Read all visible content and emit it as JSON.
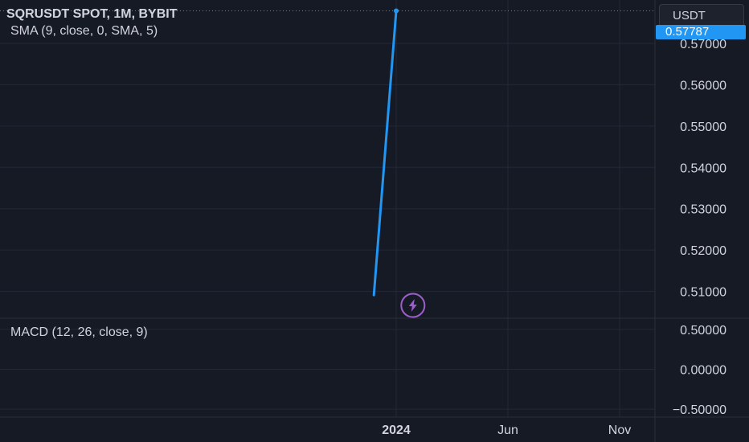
{
  "header": {
    "symbol_title": "SQRUSDT SPOT, 1M, BYBIT",
    "indicator_sma": "SMA (9, close, 0, SMA, 5)",
    "indicator_macd": "MACD (12, 26, close, 9)",
    "currency": "USDT",
    "last_price": "0.57787"
  },
  "colors": {
    "background": "#161a25",
    "grid": "#242837",
    "line": "#2196f3",
    "text": "#d1d4dc",
    "event_marker": "#9c5fc9"
  },
  "chart_data": [
    {
      "type": "line",
      "title": "SQRUSDT SPOT, 1M, BYBIT",
      "x": [
        "2023-12",
        "2024-01"
      ],
      "y": [
        0.5091,
        0.57787
      ],
      "ylim": [
        0.5035,
        0.5805
      ],
      "y_ticks": [
        0.51,
        0.52,
        0.53,
        0.54,
        0.55,
        0.56,
        0.57
      ],
      "y_tick_labels": [
        "0.51000",
        "0.52000",
        "0.53000",
        "0.54000",
        "0.55000",
        "0.56000",
        "0.57000"
      ],
      "x_ticks": [
        "2024-01",
        "2024-06",
        "2024-11"
      ],
      "x_tick_labels": [
        "2024",
        "Jun",
        "Nov"
      ],
      "last_price_line": 0.57787,
      "event_icon": "lightning-icon",
      "grid": true
    },
    {
      "type": "line",
      "title": "MACD (12, 26, close, 9)",
      "series": [],
      "ylim": [
        -0.6,
        0.64
      ],
      "y_ticks": [
        0.5,
        0.0,
        -0.5
      ],
      "y_tick_labels": [
        "0.50000",
        "0.00000",
        "−0.50000"
      ],
      "grid": true
    }
  ]
}
